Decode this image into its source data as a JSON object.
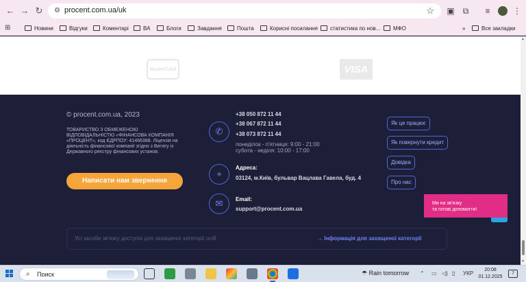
{
  "browser": {
    "url": "procent.com.ua/uk",
    "bookmarks": [
      "Новини",
      "Відгуки",
      "Коментарі",
      "ВА",
      "Блоги",
      "Завдання",
      "Пошта",
      "Корисні посилання",
      "статистика по нов...",
      "МФО"
    ],
    "all_bookmarks_label": "Все закладки",
    "overflow_label": "»"
  },
  "icons": {
    "back": "←",
    "forward": "→",
    "reload": "↻",
    "site_info": "⚙",
    "star": "☆",
    "screenshot": "▣",
    "extensions": "⧉",
    "media": "≡",
    "menu": "⋮",
    "apps": "⊞",
    "phone": "✆",
    "location": "⌖",
    "email": "✉",
    "telegram": "➤",
    "search": "⌕"
  },
  "payment_logos": {
    "mastercard": "MasterCard",
    "visa": "VISA"
  },
  "footer": {
    "copyright": "© procent.com.ua, 2023",
    "company_upper": "ТОВАРИСТВО З ОБМЕЖЕНОЮ ВІДПОВІДАЛЬНІСТЮ «ФІНАНСОВА КОМПАНІЯ «ПРОЦЕНТ», ",
    "company_rest": "код ЄДРПОУ: 41466388. Ліцензія на діяльність фінансової компанії згідно з Витягу із Державного реєстру фінансових установ.",
    "cta": "Написати нам звернення",
    "phones": [
      "+38 050 872 11 44",
      "+38 067 872 11 44",
      "+38 073 872 11 44"
    ],
    "hours_weekdays": "понеділок - п'ятниця: 9:00 - 21:00",
    "hours_weekend": "субота - неділя: 10:00 - 17:00",
    "address_label": "Адреса:",
    "address": "03124, м.Київ, бульвар Вацлава Гавела, буд. 4",
    "email_label": "Email:",
    "email": "support@procent.com.ua",
    "links": [
      "Як це працює",
      "Як повернути кредит",
      "Довідка",
      "Про нас"
    ],
    "bottom_note": "Усі засоби зв'язку доступні для захищеної категорії осіб",
    "bottom_link": "→ Інформація для захищеної категорії"
  },
  "chat_widget": {
    "line1": "Ми на зв'язку",
    "line2": "та готові допомогти!"
  },
  "taskbar": {
    "search_placeholder": "Поиск",
    "weather": "Rain tomorrow",
    "lang": "УКР",
    "time": "20:08",
    "date": "01.12.2025",
    "notifications": "7"
  },
  "colors": {
    "footer_bg": "#1c1f37",
    "accent_orange": "#f5a53a",
    "accent_blue": "#5466d8",
    "chat_pink": "#e22d86",
    "telegram": "#2aa3e0"
  }
}
